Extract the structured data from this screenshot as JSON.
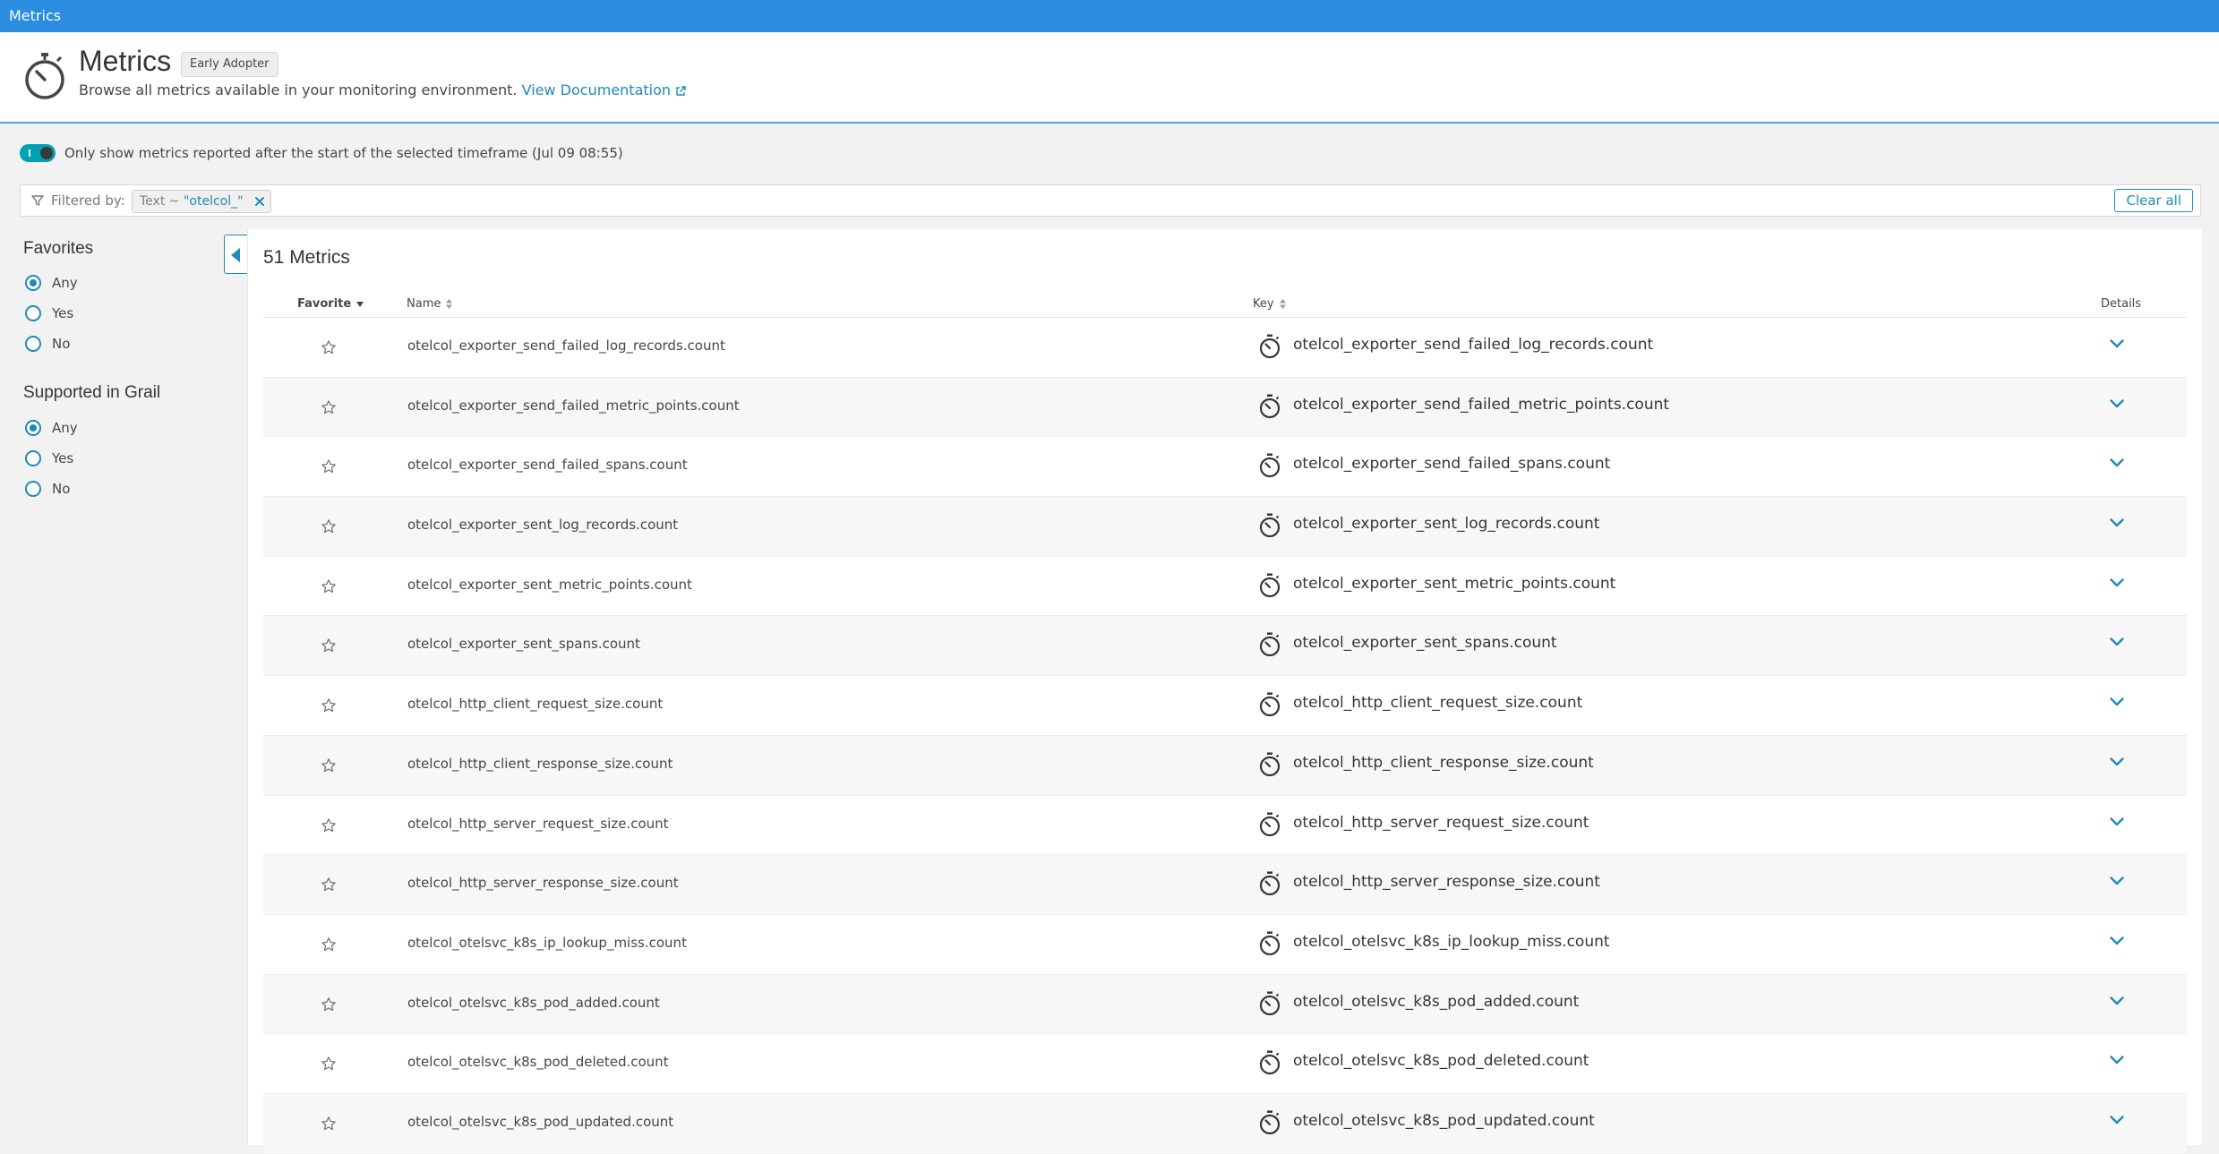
{
  "topbar": {
    "title": "Metrics"
  },
  "header": {
    "title": "Metrics",
    "badge": "Early Adopter",
    "description": "Browse all metrics available in your monitoring environment.",
    "doc_link": "View Documentation"
  },
  "toggle": {
    "label": "Only show metrics reported after the start of the selected timeframe (Jul 09 08:55)",
    "on": true
  },
  "filter": {
    "label": "Filtered by:",
    "chip_prefix": "Text ~ ",
    "chip_value": "\"otelcol_\"",
    "clear_label": "Clear all"
  },
  "sidebar": {
    "favorites": {
      "heading": "Favorites",
      "options": [
        "Any",
        "Yes",
        "No"
      ],
      "selected": "Any"
    },
    "grail": {
      "heading": "Supported in Grail",
      "options": [
        "Any",
        "Yes",
        "No"
      ],
      "selected": "Any"
    }
  },
  "table": {
    "count_label": "51 Metrics",
    "headers": {
      "favorite": "Favorite",
      "name": "Name",
      "key": "Key",
      "details": "Details"
    },
    "rows": [
      {
        "name": "otelcol_exporter_send_failed_log_records.count",
        "key": "otelcol_exporter_send_failed_log_records.count"
      },
      {
        "name": "otelcol_exporter_send_failed_metric_points.count",
        "key": "otelcol_exporter_send_failed_metric_points.count"
      },
      {
        "name": "otelcol_exporter_send_failed_spans.count",
        "key": "otelcol_exporter_send_failed_spans.count"
      },
      {
        "name": "otelcol_exporter_sent_log_records.count",
        "key": "otelcol_exporter_sent_log_records.count"
      },
      {
        "name": "otelcol_exporter_sent_metric_points.count",
        "key": "otelcol_exporter_sent_metric_points.count"
      },
      {
        "name": "otelcol_exporter_sent_spans.count",
        "key": "otelcol_exporter_sent_spans.count"
      },
      {
        "name": "otelcol_http_client_request_size.count",
        "key": "otelcol_http_client_request_size.count"
      },
      {
        "name": "otelcol_http_client_response_size.count",
        "key": "otelcol_http_client_response_size.count"
      },
      {
        "name": "otelcol_http_server_request_size.count",
        "key": "otelcol_http_server_request_size.count"
      },
      {
        "name": "otelcol_http_server_response_size.count",
        "key": "otelcol_http_server_response_size.count"
      },
      {
        "name": "otelcol_otelsvc_k8s_ip_lookup_miss.count",
        "key": "otelcol_otelsvc_k8s_ip_lookup_miss.count"
      },
      {
        "name": "otelcol_otelsvc_k8s_pod_added.count",
        "key": "otelcol_otelsvc_k8s_pod_added.count"
      },
      {
        "name": "otelcol_otelsvc_k8s_pod_deleted.count",
        "key": "otelcol_otelsvc_k8s_pod_deleted.count"
      },
      {
        "name": "otelcol_otelsvc_k8s_pod_updated.count",
        "key": "otelcol_otelsvc_k8s_pod_updated.count"
      }
    ]
  },
  "colors": {
    "topbar": "#2a8de0",
    "accent": "#1e8ab8",
    "toggle": "#00a1b2"
  },
  "icons": {
    "header": "stopwatch-icon",
    "row_star": "star-icon",
    "row_key": "stopwatch-icon",
    "row_details": "chevron-down-icon"
  }
}
